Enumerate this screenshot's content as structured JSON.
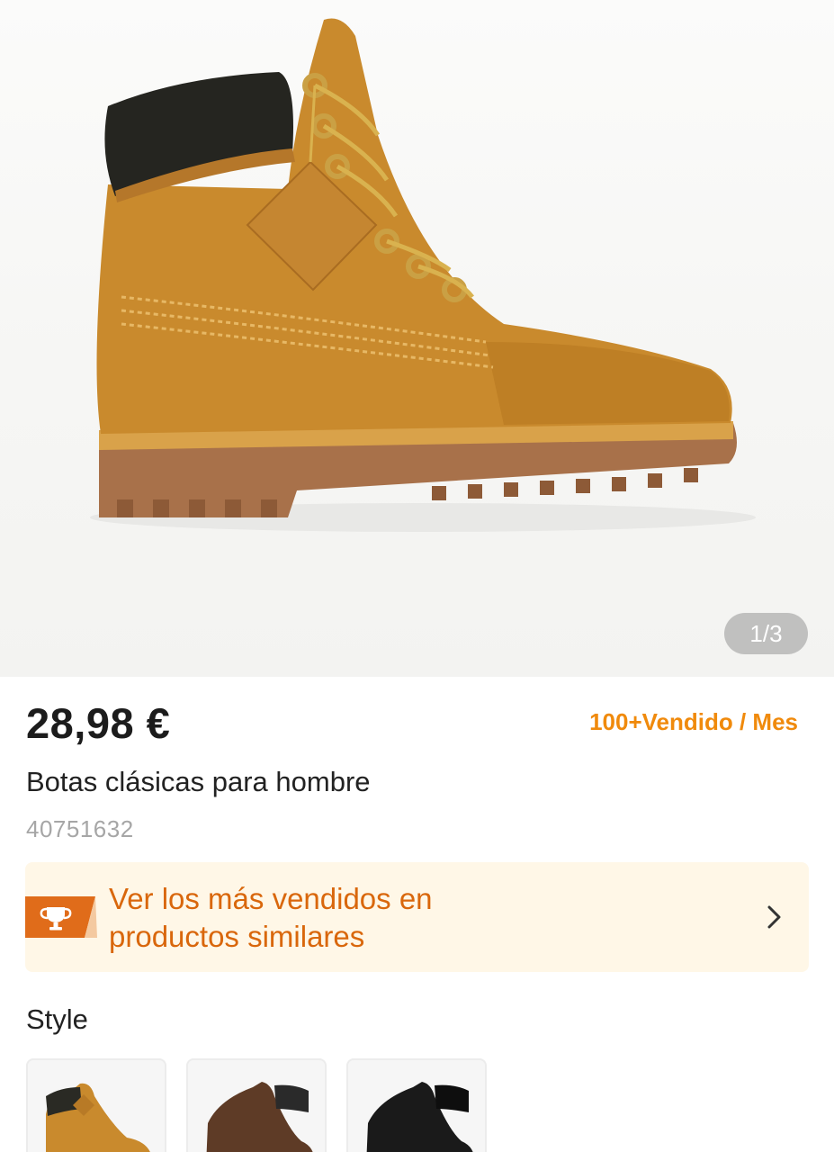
{
  "gallery": {
    "counter": "1/3",
    "image_subject": "boot-photo"
  },
  "product": {
    "price": "28,98 €",
    "sold": "100+Vendido / Mes",
    "title": "Botas clásicas para hombre",
    "sku": "40751632"
  },
  "banner": {
    "line1": "Ver los más vendidos en",
    "line2": "productos similares",
    "icon": "trophy-icon",
    "chevron": "chevron-right-icon",
    "text_color": "#d9670c",
    "background": "#fff7e7"
  },
  "style": {
    "title": "Style",
    "options": [
      {
        "color": "#c98a2d"
      },
      {
        "color": "#5e3b26"
      },
      {
        "color": "#1a1a1a"
      }
    ]
  },
  "colors": {
    "accent": "#f08a0c",
    "price": "#1c1c1c"
  }
}
